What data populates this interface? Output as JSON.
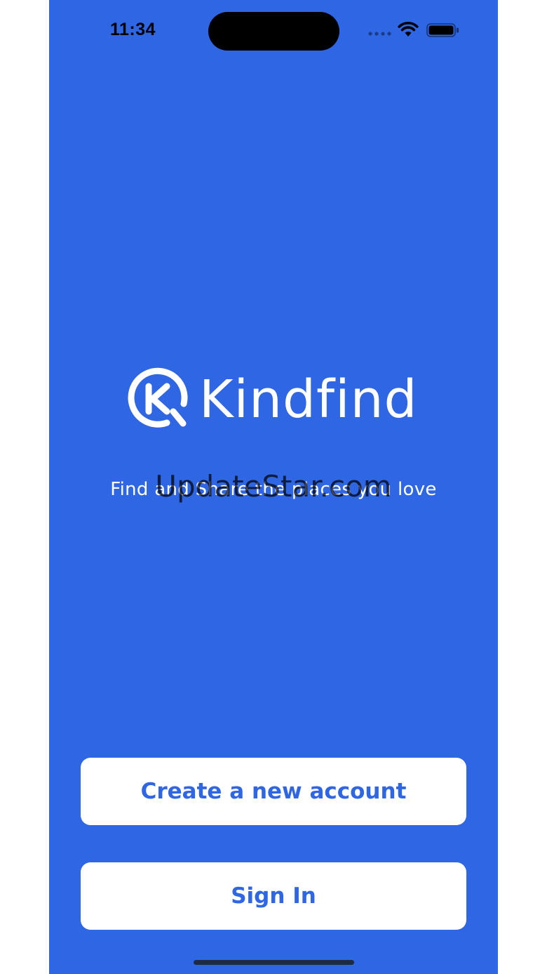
{
  "status_bar": {
    "time": "11:34"
  },
  "logo": {
    "wordmark": "Kindfind",
    "mark_letter": "K"
  },
  "tagline": "Find and Share the places you love",
  "watermark": "UpdateStar.com",
  "buttons": {
    "create_account": "Create a new account",
    "sign_in": "Sign In"
  },
  "colors": {
    "background": "#2F66E3",
    "button_bg": "#FFFFFF",
    "button_text": "#2F66E3"
  },
  "icons": [
    "signal-icon",
    "wifi-icon",
    "battery-icon",
    "logo-mark-icon"
  ]
}
